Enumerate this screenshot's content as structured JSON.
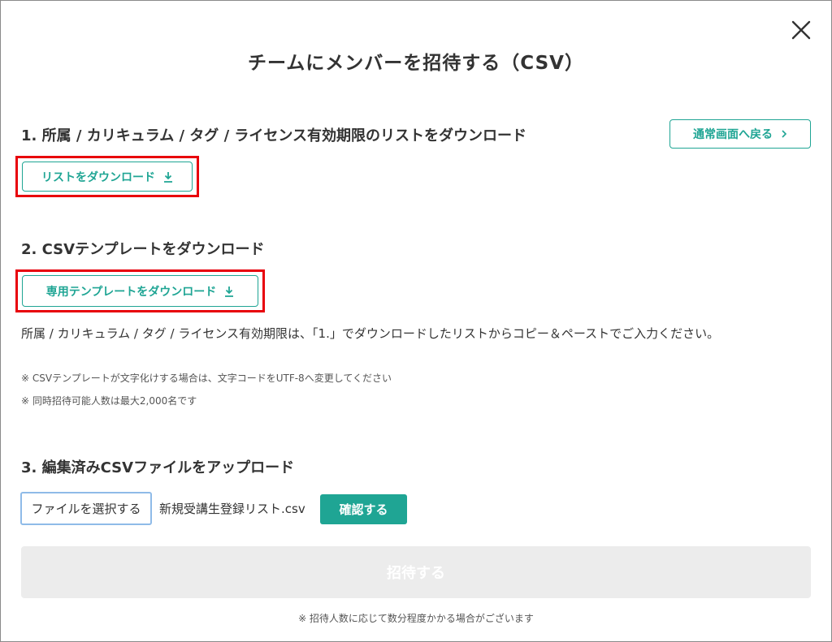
{
  "dialog": {
    "title": "チームにメンバーを招待する（CSV）",
    "close_icon": "close-icon"
  },
  "section1": {
    "heading": "1. 所属 / カリキュラム / タグ / ライセンス有効期限のリストをダウンロード",
    "download_button": "リストをダウンロード",
    "download_icon": "download-icon",
    "back_button": "通常画面へ戻る",
    "back_icon": "chevron-right-icon"
  },
  "section2": {
    "heading": "2. CSVテンプレートをダウンロード",
    "download_button": "専用テンプレートをダウンロード",
    "download_icon": "download-icon",
    "instruction": "所属 / カリキュラム / タグ / ライセンス有効期限は、「1.」でダウンロードしたリストからコピー＆ペーストでご入力ください。",
    "notes": [
      "※ CSVテンプレートが文字化けする場合は、文字コードをUTF-8へ変更してください",
      "※ 同時招待可能人数は最大2,000名です"
    ]
  },
  "section3": {
    "heading": "3. 編集済みCSVファイルをアップロード",
    "file_button": "ファイルを選択する",
    "file_name": "新規受講生登録リスト.csv",
    "confirm_button": "確認する"
  },
  "footer": {
    "invite_button": "招待する",
    "note": "※ 招待人数に応じて数分程度かかる場合がございます"
  },
  "colors": {
    "accent": "#1fa594",
    "highlight": "#e8000b",
    "disabled": "#ececec"
  }
}
